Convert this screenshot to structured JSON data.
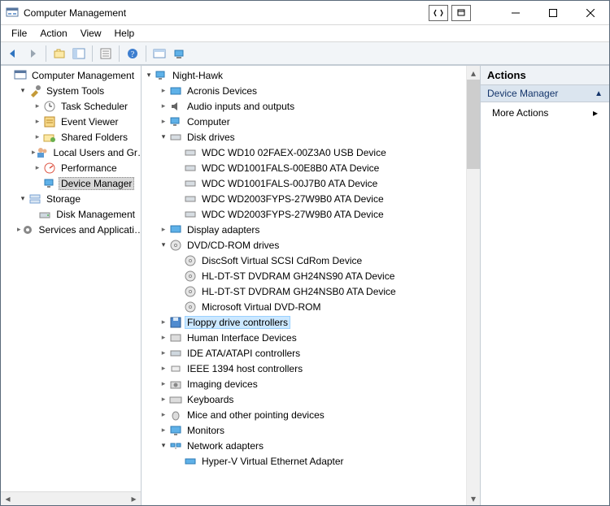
{
  "window": {
    "title": "Computer Management"
  },
  "menu": {
    "file": "File",
    "action": "Action",
    "view": "View",
    "help": "Help"
  },
  "left": {
    "root": "Computer Management",
    "system_tools": "System Tools",
    "task_scheduler": "Task Scheduler",
    "event_viewer": "Event Viewer",
    "shared_folders": "Shared Folders",
    "local_users": "Local Users and Gr…",
    "performance": "Performance",
    "device_manager": "Device Manager",
    "storage": "Storage",
    "disk_management": "Disk Management",
    "services_apps": "Services and Applicati…"
  },
  "mid": {
    "root": "Night-Hawk",
    "acronis": "Acronis Devices",
    "audio": "Audio inputs and outputs",
    "computer": "Computer",
    "disk_drives": "Disk drives",
    "disks": [
      "WDC WD10 02FAEX-00Z3A0 USB Device",
      "WDC WD1001FALS-00E8B0 ATA Device",
      "WDC WD1001FALS-00J7B0 ATA Device",
      "WDC WD2003FYPS-27W9B0 ATA Device",
      "WDC WD2003FYPS-27W9B0 ATA Device"
    ],
    "display": "Display adapters",
    "dvd": "DVD/CD-ROM drives",
    "dvds": [
      "DiscSoft Virtual SCSI CdRom Device",
      "HL-DT-ST DVDRAM GH24NS90 ATA Device",
      "HL-DT-ST DVDRAM GH24NSB0 ATA Device",
      "Microsoft Virtual DVD-ROM"
    ],
    "floppy": "Floppy drive controllers",
    "hid": "Human Interface Devices",
    "ide": "IDE ATA/ATAPI controllers",
    "ieee": "IEEE 1394 host controllers",
    "imaging": "Imaging devices",
    "keyboards": "Keyboards",
    "mice": "Mice and other pointing devices",
    "monitors": "Monitors",
    "network": "Network adapters",
    "nets": [
      "Hyper-V Virtual Ethernet Adapter"
    ]
  },
  "right": {
    "header": "Actions",
    "section": "Device Manager",
    "more_actions": "More Actions"
  }
}
